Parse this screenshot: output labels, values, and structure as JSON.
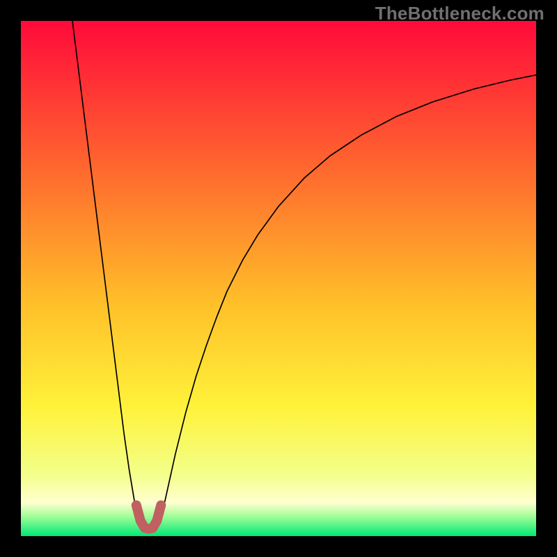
{
  "watermark": "TheBottleneck.com",
  "chart_data": {
    "type": "line",
    "title": "",
    "xlabel": "",
    "ylabel": "",
    "xlim": [
      0,
      100
    ],
    "ylim": [
      0,
      100
    ],
    "grid": false,
    "background": {
      "type": "vertical-gradient",
      "stops": [
        {
          "pos": 0,
          "color": "#ff0a3a"
        },
        {
          "pos": 30,
          "color": "#ff6c2e"
        },
        {
          "pos": 55,
          "color": "#ffc029"
        },
        {
          "pos": 75,
          "color": "#fff23a"
        },
        {
          "pos": 88,
          "color": "#f3ff8a"
        },
        {
          "pos": 93.5,
          "color": "#ffffd0"
        },
        {
          "pos": 96,
          "color": "#a8ff9a"
        },
        {
          "pos": 100,
          "color": "#00e874"
        }
      ]
    },
    "series": [
      {
        "name": "curve",
        "color": "#000000",
        "stroke_width": 1.7,
        "x": [
          10.0,
          11.0,
          12.0,
          13.0,
          14.0,
          15.0,
          16.0,
          17.0,
          18.0,
          19.0,
          20.0,
          21.0,
          22.0,
          23.0,
          24.0,
          25.0,
          26.0,
          27.0,
          28.0,
          30.0,
          32.0,
          34.0,
          36.0,
          38.0,
          40.0,
          43.0,
          46.0,
          50.0,
          55.0,
          60.0,
          66.0,
          73.0,
          80.0,
          88.0,
          95.0,
          100.0
        ],
        "y": [
          100.0,
          92.0,
          84.0,
          76.0,
          68.0,
          60.0,
          52.0,
          44.0,
          36.0,
          28.0,
          20.0,
          13.0,
          7.0,
          3.0,
          1.5,
          1.2,
          1.5,
          3.0,
          7.0,
          16.0,
          24.0,
          31.0,
          37.0,
          42.5,
          47.5,
          53.5,
          58.5,
          64.0,
          69.5,
          73.8,
          77.8,
          81.5,
          84.3,
          86.8,
          88.5,
          89.5
        ]
      },
      {
        "name": "highlight-marker",
        "color": "#c06060",
        "stroke_width": 14,
        "linecap": "round",
        "x": [
          22.4,
          23.2,
          24.0,
          24.8,
          25.6,
          26.4,
          27.2
        ],
        "y": [
          6.0,
          3.0,
          1.6,
          1.4,
          1.6,
          3.0,
          6.0
        ]
      }
    ]
  }
}
